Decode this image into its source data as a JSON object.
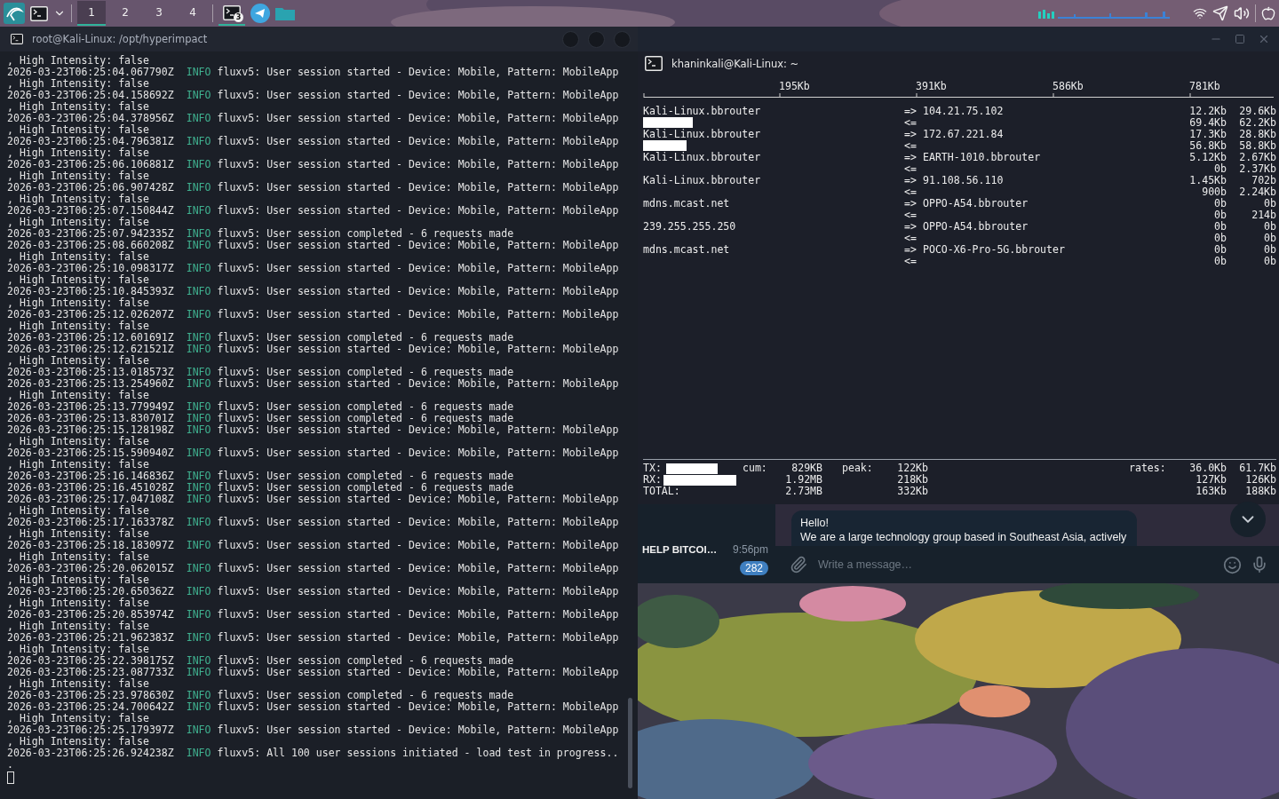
{
  "taskbar": {
    "workspaces": [
      {
        "label": "1",
        "selected": true
      },
      {
        "label": "2",
        "selected": false
      },
      {
        "label": "3",
        "selected": false
      },
      {
        "label": "4",
        "selected": false
      }
    ],
    "app_badge": "3"
  },
  "left_terminal": {
    "title": "root@Kali-Linux: /opt/hyperimpact",
    "lines": [
      {
        "kind": "text",
        "text": ", High Intensity: false"
      },
      {
        "kind": "entry",
        "timestamp": "2026-03-23T06:25:04.067790Z",
        "level": "INFO",
        "message": "fluxv5: User session started - Device: Mobile, Pattern: MobileApp"
      },
      {
        "kind": "text",
        "text": ", High Intensity: false"
      },
      {
        "kind": "entry",
        "timestamp": "2026-03-23T06:25:04.158692Z",
        "level": "INFO",
        "message": "fluxv5: User session started - Device: Mobile, Pattern: MobileApp"
      },
      {
        "kind": "text",
        "text": ", High Intensity: false"
      },
      {
        "kind": "entry",
        "timestamp": "2026-03-23T06:25:04.378956Z",
        "level": "INFO",
        "message": "fluxv5: User session started - Device: Mobile, Pattern: MobileApp"
      },
      {
        "kind": "text",
        "text": ", High Intensity: false"
      },
      {
        "kind": "entry",
        "timestamp": "2026-03-23T06:25:04.796381Z",
        "level": "INFO",
        "message": "fluxv5: User session started - Device: Mobile, Pattern: MobileApp"
      },
      {
        "kind": "text",
        "text": ", High Intensity: false"
      },
      {
        "kind": "entry",
        "timestamp": "2026-03-23T06:25:06.106881Z",
        "level": "INFO",
        "message": "fluxv5: User session started - Device: Mobile, Pattern: MobileApp"
      },
      {
        "kind": "text",
        "text": ", High Intensity: false"
      },
      {
        "kind": "entry",
        "timestamp": "2026-03-23T06:25:06.907428Z",
        "level": "INFO",
        "message": "fluxv5: User session started - Device: Mobile, Pattern: MobileApp"
      },
      {
        "kind": "text",
        "text": ", High Intensity: false"
      },
      {
        "kind": "entry",
        "timestamp": "2026-03-23T06:25:07.150844Z",
        "level": "INFO",
        "message": "fluxv5: User session started - Device: Mobile, Pattern: MobileApp"
      },
      {
        "kind": "text",
        "text": ", High Intensity: false"
      },
      {
        "kind": "entry",
        "timestamp": "2026-03-23T06:25:07.942335Z",
        "level": "INFO",
        "message": "fluxv5: User session completed - 6 requests made"
      },
      {
        "kind": "entry",
        "timestamp": "2026-03-23T06:25:08.660208Z",
        "level": "INFO",
        "message": "fluxv5: User session started - Device: Mobile, Pattern: MobileApp"
      },
      {
        "kind": "text",
        "text": ", High Intensity: false"
      },
      {
        "kind": "entry",
        "timestamp": "2026-03-23T06:25:10.098317Z",
        "level": "INFO",
        "message": "fluxv5: User session started - Device: Mobile, Pattern: MobileApp"
      },
      {
        "kind": "text",
        "text": ", High Intensity: false"
      },
      {
        "kind": "entry",
        "timestamp": "2026-03-23T06:25:10.845393Z",
        "level": "INFO",
        "message": "fluxv5: User session started - Device: Mobile, Pattern: MobileApp"
      },
      {
        "kind": "text",
        "text": ", High Intensity: false"
      },
      {
        "kind": "entry",
        "timestamp": "2026-03-23T06:25:12.026207Z",
        "level": "INFO",
        "message": "fluxv5: User session started - Device: Mobile, Pattern: MobileApp"
      },
      {
        "kind": "text",
        "text": ", High Intensity: false"
      },
      {
        "kind": "entry",
        "timestamp": "2026-03-23T06:25:12.601691Z",
        "level": "INFO",
        "message": "fluxv5: User session completed - 6 requests made"
      },
      {
        "kind": "entry",
        "timestamp": "2026-03-23T06:25:12.621521Z",
        "level": "INFO",
        "message": "fluxv5: User session started - Device: Mobile, Pattern: MobileApp"
      },
      {
        "kind": "text",
        "text": ", High Intensity: false"
      },
      {
        "kind": "entry",
        "timestamp": "2026-03-23T06:25:13.018573Z",
        "level": "INFO",
        "message": "fluxv5: User session completed - 6 requests made"
      },
      {
        "kind": "entry",
        "timestamp": "2026-03-23T06:25:13.254960Z",
        "level": "INFO",
        "message": "fluxv5: User session started - Device: Mobile, Pattern: MobileApp"
      },
      {
        "kind": "text",
        "text": ", High Intensity: false"
      },
      {
        "kind": "entry",
        "timestamp": "2026-03-23T06:25:13.779949Z",
        "level": "INFO",
        "message": "fluxv5: User session completed - 6 requests made"
      },
      {
        "kind": "entry",
        "timestamp": "2026-03-23T06:25:13.830701Z",
        "level": "INFO",
        "message": "fluxv5: User session completed - 6 requests made"
      },
      {
        "kind": "entry",
        "timestamp": "2026-03-23T06:25:15.128198Z",
        "level": "INFO",
        "message": "fluxv5: User session started - Device: Mobile, Pattern: MobileApp"
      },
      {
        "kind": "text",
        "text": ", High Intensity: false"
      },
      {
        "kind": "entry",
        "timestamp": "2026-03-23T06:25:15.590940Z",
        "level": "INFO",
        "message": "fluxv5: User session started - Device: Mobile, Pattern: MobileApp"
      },
      {
        "kind": "text",
        "text": ", High Intensity: false"
      },
      {
        "kind": "entry",
        "timestamp": "2026-03-23T06:25:16.146836Z",
        "level": "INFO",
        "message": "fluxv5: User session completed - 6 requests made"
      },
      {
        "kind": "entry",
        "timestamp": "2026-03-23T06:25:16.451028Z",
        "level": "INFO",
        "message": "fluxv5: User session completed - 6 requests made"
      },
      {
        "kind": "entry",
        "timestamp": "2026-03-23T06:25:17.047108Z",
        "level": "INFO",
        "message": "fluxv5: User session started - Device: Mobile, Pattern: MobileApp"
      },
      {
        "kind": "text",
        "text": ", High Intensity: false"
      },
      {
        "kind": "entry",
        "timestamp": "2026-03-23T06:25:17.163378Z",
        "level": "INFO",
        "message": "fluxv5: User session started - Device: Mobile, Pattern: MobileApp"
      },
      {
        "kind": "text",
        "text": ", High Intensity: false"
      },
      {
        "kind": "entry",
        "timestamp": "2026-03-23T06:25:18.183097Z",
        "level": "INFO",
        "message": "fluxv5: User session started - Device: Mobile, Pattern: MobileApp"
      },
      {
        "kind": "text",
        "text": ", High Intensity: false"
      },
      {
        "kind": "entry",
        "timestamp": "2026-03-23T06:25:20.062015Z",
        "level": "INFO",
        "message": "fluxv5: User session started - Device: Mobile, Pattern: MobileApp"
      },
      {
        "kind": "text",
        "text": ", High Intensity: false"
      },
      {
        "kind": "entry",
        "timestamp": "2026-03-23T06:25:20.650362Z",
        "level": "INFO",
        "message": "fluxv5: User session started - Device: Mobile, Pattern: MobileApp"
      },
      {
        "kind": "text",
        "text": ", High Intensity: false"
      },
      {
        "kind": "entry",
        "timestamp": "2026-03-23T06:25:20.853974Z",
        "level": "INFO",
        "message": "fluxv5: User session started - Device: Mobile, Pattern: MobileApp"
      },
      {
        "kind": "text",
        "text": ", High Intensity: false"
      },
      {
        "kind": "entry",
        "timestamp": "2026-03-23T06:25:21.962383Z",
        "level": "INFO",
        "message": "fluxv5: User session started - Device: Mobile, Pattern: MobileApp"
      },
      {
        "kind": "text",
        "text": ", High Intensity: false"
      },
      {
        "kind": "entry",
        "timestamp": "2026-03-23T06:25:22.398175Z",
        "level": "INFO",
        "message": "fluxv5: User session completed - 6 requests made"
      },
      {
        "kind": "entry",
        "timestamp": "2026-03-23T06:25:23.087733Z",
        "level": "INFO",
        "message": "fluxv5: User session started - Device: Mobile, Pattern: MobileApp"
      },
      {
        "kind": "text",
        "text": ", High Intensity: false"
      },
      {
        "kind": "entry",
        "timestamp": "2026-03-23T06:25:23.978630Z",
        "level": "INFO",
        "message": "fluxv5: User session completed - 6 requests made"
      },
      {
        "kind": "entry",
        "timestamp": "2026-03-23T06:25:24.700642Z",
        "level": "INFO",
        "message": "fluxv5: User session started - Device: Mobile, Pattern: MobileApp"
      },
      {
        "kind": "text",
        "text": ", High Intensity: false"
      },
      {
        "kind": "entry",
        "timestamp": "2026-03-23T06:25:25.179397Z",
        "level": "INFO",
        "message": "fluxv5: User session started - Device: Mobile, Pattern: MobileApp"
      },
      {
        "kind": "text",
        "text": ", High Intensity: false"
      },
      {
        "kind": "entry",
        "timestamp": "2026-03-23T06:25:26.924238Z",
        "level": "INFO",
        "message": "fluxv5: All 100 user sessions initiated - load test in progress.."
      },
      {
        "kind": "text",
        "text": "."
      }
    ]
  },
  "right_terminal": {
    "title": "khaninkali@Kali-Linux: ~",
    "scale": [
      "195Kb",
      "391Kb",
      "586Kb",
      "781Kb"
    ],
    "rows": [
      {
        "source": "Kali-Linux.bbrouter",
        "out_arrow": "=>",
        "destination": "104.21.75.102",
        "out_rates": [
          "12.2Kb",
          "29.6Kb"
        ],
        "in_arrow": "<=",
        "in_rates": [
          "69.4Kb",
          "62.2Kb"
        ],
        "redacted": true
      },
      {
        "source": "Kali-Linux.bbrouter",
        "out_arrow": "=>",
        "destination": "172.67.221.84",
        "out_rates": [
          "17.3Kb",
          "28.8Kb"
        ],
        "in_arrow": "<=",
        "in_rates": [
          "56.8Kb",
          "58.8Kb"
        ],
        "redacted": true
      },
      {
        "source": "Kali-Linux.bbrouter",
        "out_arrow": "=>",
        "destination": "EARTH-1010.bbrouter",
        "out_rates": [
          "5.12Kb",
          "2.67Kb"
        ],
        "in_arrow": "<=",
        "in_rates": [
          "0b",
          "2.37Kb"
        ],
        "redacted": false
      },
      {
        "source": "Kali-Linux.bbrouter",
        "out_arrow": "=>",
        "destination": "91.108.56.110",
        "out_rates": [
          "1.45Kb",
          "702b"
        ],
        "in_arrow": "<=",
        "in_rates": [
          "900b",
          "2.24Kb"
        ],
        "redacted": false
      },
      {
        "source": "mdns.mcast.net",
        "out_arrow": "=>",
        "destination": "OPPO-A54.bbrouter",
        "out_rates": [
          "0b",
          "0b"
        ],
        "in_arrow": "<=",
        "in_rates": [
          "0b",
          "214b"
        ],
        "redacted": false
      },
      {
        "source": "239.255.255.250",
        "out_arrow": "=>",
        "destination": "OPPO-A54.bbrouter",
        "out_rates": [
          "0b",
          "0b"
        ],
        "in_arrow": "<=",
        "in_rates": [
          "0b",
          "0b"
        ],
        "redacted": false
      },
      {
        "source": "mdns.mcast.net",
        "out_arrow": "=>",
        "destination": "POCO-X6-Pro-5G.bbrouter",
        "out_rates": [
          "0b",
          "0b"
        ],
        "in_arrow": "<=",
        "in_rates": [
          "0b",
          "0b"
        ],
        "redacted": false
      }
    ],
    "totals": [
      {
        "label": "TX:",
        "cum_label": "cum:",
        "cum": "829KB",
        "peak_label": "peak:",
        "peak": "122Kb",
        "rates_label": "rates:",
        "rates": [
          "36.0Kb",
          "61.7Kb"
        ],
        "redacted": true
      },
      {
        "label": "RX:",
        "cum": "1.92MB",
        "peak": "218Kb",
        "rates": [
          "127Kb",
          "126Kb"
        ],
        "redacted": true
      },
      {
        "label": "TOTAL:",
        "cum": "2.73MB",
        "peak": "332Kb",
        "rates": [
          "163Kb",
          "188Kb"
        ],
        "redacted": false
      }
    ]
  },
  "telegram": {
    "chat": {
      "name": "HELP BITCOI…",
      "time": "9:56pm",
      "unread": "282"
    },
    "message": {
      "lines": [
        "Hello!",
        "We are a large technology group based in Southeast Asia, actively"
      ]
    },
    "composer": {
      "placeholder": "Write a message…"
    }
  }
}
